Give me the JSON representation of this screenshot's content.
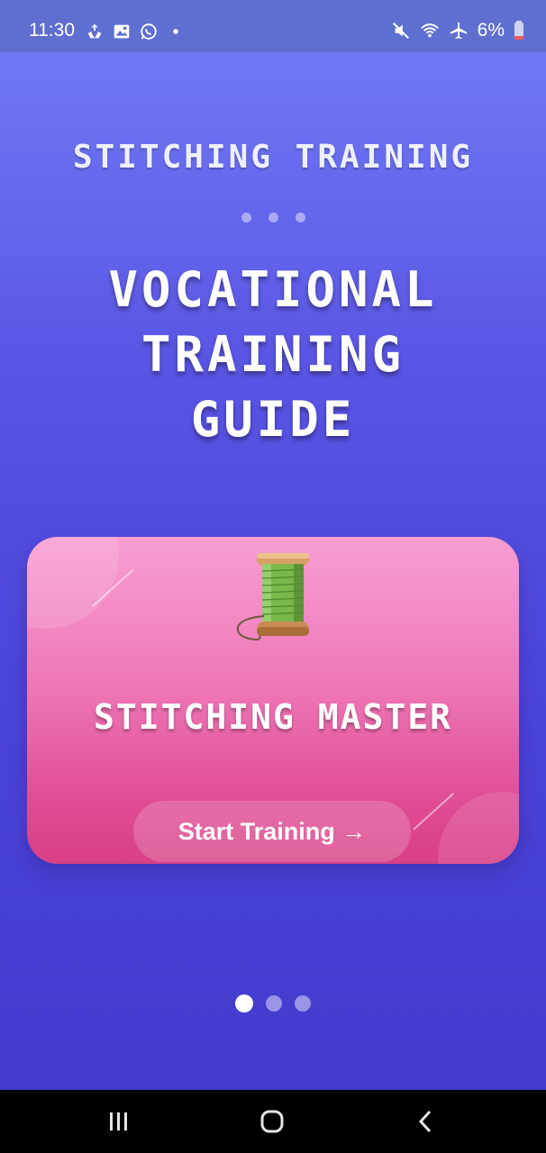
{
  "status_bar": {
    "time": "11:30",
    "battery_pct": "6%",
    "left_icons": [
      "sync-icon",
      "image-icon",
      "whatsapp-icon",
      "dot-icon"
    ],
    "right_icons": [
      "mute-icon",
      "wifi-icon",
      "airplane-icon",
      "battery-icon"
    ]
  },
  "hero": {
    "kicker": "STITCHING TRAINING",
    "headline_line1": "VOCATIONAL",
    "headline_line2": "TRAINING",
    "headline_line3": "GUIDE"
  },
  "card": {
    "icon": "thread-spool-icon",
    "title": "STITCHING MASTER",
    "button_label": "Start Training →"
  },
  "pager": {
    "total": 3,
    "active_index": 0
  },
  "colors": {
    "background_top": "#7078f3",
    "background_bottom": "#433bce",
    "card_top": "#f79ed2",
    "card_bottom": "#d83f86"
  }
}
